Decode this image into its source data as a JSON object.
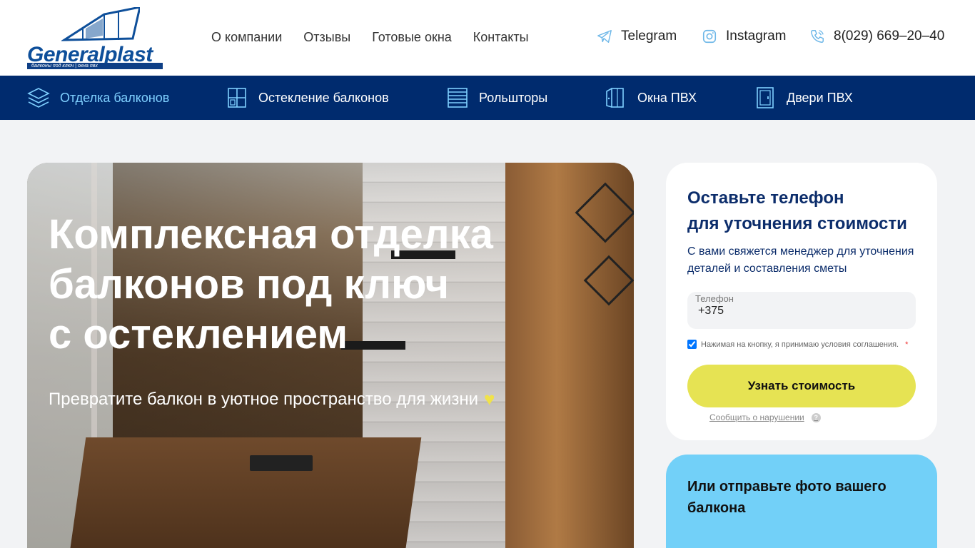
{
  "logo": {
    "brand": "Generalplast",
    "tagline": "балконы под ключ | окна пвх"
  },
  "topnav": [
    {
      "label": "О компании"
    },
    {
      "label": "Отзывы"
    },
    {
      "label": "Готовые окна"
    },
    {
      "label": "Контакты"
    }
  ],
  "contacts": {
    "telegram": "Telegram",
    "instagram": "Instagram",
    "phone": "8(029) 669–20–40"
  },
  "categories": [
    {
      "label": "Отделка балконов",
      "icon": "layers-icon",
      "active": true
    },
    {
      "label": "Остекление балконов",
      "icon": "window-frame-icon",
      "active": false
    },
    {
      "label": "Рольшторы",
      "icon": "roller-blind-icon",
      "active": false
    },
    {
      "label": "Окна ПВХ",
      "icon": "open-window-icon",
      "active": false
    },
    {
      "label": "Двери ПВХ",
      "icon": "door-icon",
      "active": false
    }
  ],
  "hero": {
    "title_line1": "Комплексная отделка",
    "title_line2": "балконов под ключ",
    "title_line3": "с остеклением",
    "subtitle": "Превратите балкон в уютное пространство для жизни",
    "heart": "♥"
  },
  "form": {
    "title_line1": "Оставьте телефон",
    "title_line2": "для уточнения стоимости",
    "description": "С вами свяжется менеджер для уточнения деталей и составления сметы",
    "phone_label": "Телефон",
    "phone_value": "+375",
    "agree_text": "Нажимая на кнопку, я принимаю условия соглашения.",
    "agree_required": "*",
    "agree_checked": true,
    "submit_label": "Узнать стоимость",
    "report_label": "Сообщить о нарушении",
    "help": "?"
  },
  "photo_card": {
    "title": "Или отправьте фото вашего балкона"
  },
  "colors": {
    "brand_blue": "#002b6e",
    "active_nav": "#7fd0ff",
    "button_yellow": "#e6e353",
    "photo_card_blue": "#72d0f8",
    "text_navy": "#0c2d6b"
  }
}
